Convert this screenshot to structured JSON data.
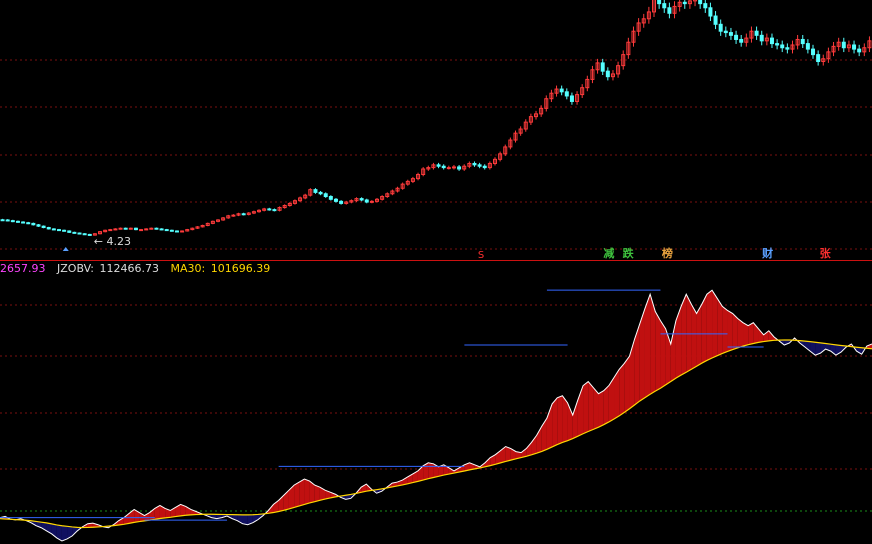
{
  "indicator_header": {
    "prev_value": "2657.93",
    "jzobv_label": "JZOBV:",
    "jzobv_value": "112466.73",
    "ma30_label": "MA30:",
    "ma30_value": "101696.39"
  },
  "price_annotation": "4.23",
  "badges": [
    {
      "text": "减",
      "color": "#3ec23e",
      "pos": 0.692
    },
    {
      "text": "跌",
      "color": "#3ec23e",
      "pos": 0.714
    },
    {
      "text": "榜",
      "color": "#e8a23e",
      "pos": 0.759
    },
    {
      "text": "财",
      "color": "#5aa0ff",
      "pos": 0.874
    },
    {
      "text": "张",
      "color": "#ff3030",
      "pos": 0.94
    }
  ],
  "marker_s": "S",
  "colors": {
    "up": "#ff3b3b",
    "down": "#55ffff",
    "grid": "#7a1010",
    "separator": "#cc1111",
    "ma30": "#ffd700",
    "jzobv_line": "#ffffff",
    "fill_pos": "#c01010",
    "fill_neg": "#101060",
    "resistance": "#3366ff",
    "baseline": "#1a8c1a"
  },
  "chart_data": [
    {
      "type": "candlestick",
      "title": "",
      "close": [
        3.2,
        3.15,
        3.1,
        3.05,
        3.0,
        2.95,
        2.85,
        2.75,
        2.65,
        2.55,
        2.5,
        2.45,
        2.4,
        2.3,
        2.25,
        2.2,
        2.15,
        2.1,
        2.2,
        2.35,
        2.45,
        2.5,
        2.55,
        2.6,
        2.55,
        2.6,
        2.5,
        2.5,
        2.55,
        2.6,
        2.55,
        2.5,
        2.45,
        2.4,
        2.35,
        2.4,
        2.5,
        2.6,
        2.7,
        2.8,
        2.95,
        3.1,
        3.2,
        3.35,
        3.5,
        3.55,
        3.65,
        3.6,
        3.7,
        3.8,
        3.9,
        4.0,
        3.95,
        3.9,
        4.1,
        4.25,
        4.4,
        4.6,
        4.8,
        5.0,
        5.4,
        5.2,
        5.1,
        4.9,
        4.7,
        4.55,
        4.4,
        4.5,
        4.6,
        4.75,
        4.65,
        4.5,
        4.55,
        4.7,
        4.9,
        5.1,
        5.3,
        5.5,
        5.8,
        6.0,
        6.2,
        6.5,
        6.9,
        7.0,
        7.2,
        7.1,
        7.0,
        7.0,
        7.05,
        6.9,
        7.1,
        7.3,
        7.2,
        7.1,
        7.0,
        7.3,
        7.6,
        8.0,
        8.5,
        9.0,
        9.5,
        9.8,
        10.3,
        10.7,
        10.9,
        11.3,
        12.0,
        12.4,
        12.7,
        12.5,
        12.2,
        11.8,
        12.3,
        12.8,
        13.4,
        14.1,
        14.6,
        14.0,
        13.6,
        13.8,
        14.4,
        15.2,
        16.1,
        16.9,
        17.5,
        17.8,
        18.3,
        19.2,
        18.9,
        18.6,
        18.2,
        18.7,
        19.0,
        18.9,
        19.1,
        19.3,
        18.9,
        18.6,
        18.0,
        17.4,
        16.9,
        16.8,
        16.6,
        16.3,
        16.1,
        16.4,
        16.9,
        16.6,
        16.2,
        16.4,
        16.0,
        15.9,
        15.7,
        15.6,
        15.9,
        16.3,
        16.0,
        15.6,
        15.2,
        14.7,
        14.9,
        15.4,
        15.8,
        16.1,
        15.7,
        15.9,
        15.6,
        15.4,
        15.7,
        16.2
      ],
      "price_min": 1.6,
      "price_max": 19.6,
      "annotation_low": 4.23
    },
    {
      "type": "area",
      "title": "JZOBV",
      "series": [
        {
          "name": "JZOBV",
          "values": [
            4000,
            5200,
            2500,
            1800,
            3000,
            1200,
            -1000,
            -4000,
            -6000,
            -9000,
            -12000,
            -16000,
            -19000,
            -17000,
            -14000,
            -9000,
            -5000,
            -2000,
            -1500,
            -3000,
            -5000,
            -6000,
            -3000,
            1000,
            4000,
            8000,
            12000,
            9000,
            6000,
            9000,
            13000,
            16000,
            13000,
            11000,
            14000,
            17000,
            15000,
            12000,
            10000,
            8000,
            6000,
            4000,
            3000,
            4000,
            5500,
            3000,
            1000,
            -2000,
            -3000,
            -1000,
            2000,
            6000,
            11000,
            17000,
            21000,
            26000,
            31000,
            36000,
            39000,
            42000,
            40000,
            36000,
            34000,
            31000,
            29000,
            27000,
            24000,
            22000,
            23000,
            28000,
            34000,
            37000,
            32000,
            28000,
            30000,
            34000,
            38000,
            39000,
            41000,
            44000,
            47000,
            50000,
            55000,
            58000,
            57000,
            54000,
            56000,
            53000,
            50000,
            53000,
            56000,
            58000,
            56000,
            54000,
            58000,
            63000,
            66000,
            70000,
            74000,
            72000,
            69000,
            68000,
            72000,
            78000,
            85000,
            94000,
            102000,
            116000,
            122000,
            124000,
            117000,
            105000,
            120000,
            134000,
            138000,
            132000,
            126000,
            129000,
            134000,
            142000,
            150000,
            156000,
            163000,
            180000,
            195000,
            210000,
            224000,
            207000,
            198000,
            190000,
            175000,
            198000,
            212000,
            224000,
            214000,
            205000,
            214000,
            224000,
            228000,
            220000,
            212000,
            208000,
            205000,
            200000,
            196000,
            193000,
            196000,
            190000,
            184000,
            188000,
            182000,
            178000,
            174000,
            176000,
            181000,
            176000,
            172000,
            168000,
            164000,
            166000,
            170000,
            168000,
            164000,
            167000,
            172000,
            175000,
            168000,
            165000,
            173000,
            175000
          ]
        },
        {
          "name": "MA30",
          "values": [
            3000,
            2600,
            2300,
            2000,
            1700,
            1400,
            900,
            200,
            -500,
            -1200,
            -2200,
            -3200,
            -4000,
            -4600,
            -5200,
            -5600,
            -5800,
            -5700,
            -5500,
            -5200,
            -4800,
            -4400,
            -3900,
            -3300,
            -2600,
            -1700,
            -700,
            100,
            800,
            1500,
            2300,
            3100,
            3700,
            4300,
            5000,
            5700,
            6300,
            6700,
            7000,
            7200,
            7300,
            7300,
            7200,
            7100,
            7000,
            6900,
            6800,
            6700,
            6700,
            6800,
            7100,
            7600,
            8200,
            9000,
            10000,
            11200,
            12500,
            14000,
            15500,
            17000,
            18400,
            19700,
            21000,
            22300,
            23400,
            24400,
            25200,
            26000,
            26800,
            27800,
            28900,
            30000,
            30800,
            31500,
            32300,
            33200,
            34200,
            35200,
            36200,
            37300,
            38500,
            39700,
            41000,
            42300,
            43500,
            44700,
            45900,
            46900,
            47900,
            48900,
            49900,
            51000,
            52000,
            52900,
            54000,
            55200,
            56500,
            57900,
            59300,
            60600,
            61900,
            63100,
            64400,
            65800,
            67400,
            69200,
            71300,
            73600,
            75900,
            78000,
            79800,
            81900,
            84200,
            86600,
            88800,
            90900,
            93100,
            95500,
            98200,
            101100,
            104200,
            107600,
            111200,
            115000,
            118900,
            122200,
            125500,
            128600,
            131400,
            134700,
            138000,
            141400,
            144400,
            147200,
            150100,
            153100,
            156100,
            158800,
            161200,
            163500,
            165700,
            167700,
            169500,
            171200,
            172900,
            174300,
            175500,
            176600,
            177400,
            178100,
            178600,
            178800,
            179000,
            178900,
            178700,
            178300,
            177800,
            177300,
            176700,
            176100,
            175500,
            174800,
            174100,
            173500,
            173000,
            172400,
            171800,
            171300,
            170800,
            170300
          ]
        }
      ],
      "value_min": -22000,
      "value_max": 240000,
      "resistance_levels": [
        {
          "value": 4000,
          "start": 0,
          "end": 30
        },
        {
          "value": 1500,
          "start": 28,
          "end": 44
        },
        {
          "value": 54500,
          "start": 54,
          "end": 90
        },
        {
          "value": 174000,
          "start": 90,
          "end": 108
        },
        {
          "value": 174000,
          "start": 107,
          "end": 110
        },
        {
          "value": 228000,
          "start": 106,
          "end": 128
        },
        {
          "value": 185000,
          "start": 128,
          "end": 141
        },
        {
          "value": 172000,
          "start": 141,
          "end": 148
        }
      ]
    }
  ]
}
